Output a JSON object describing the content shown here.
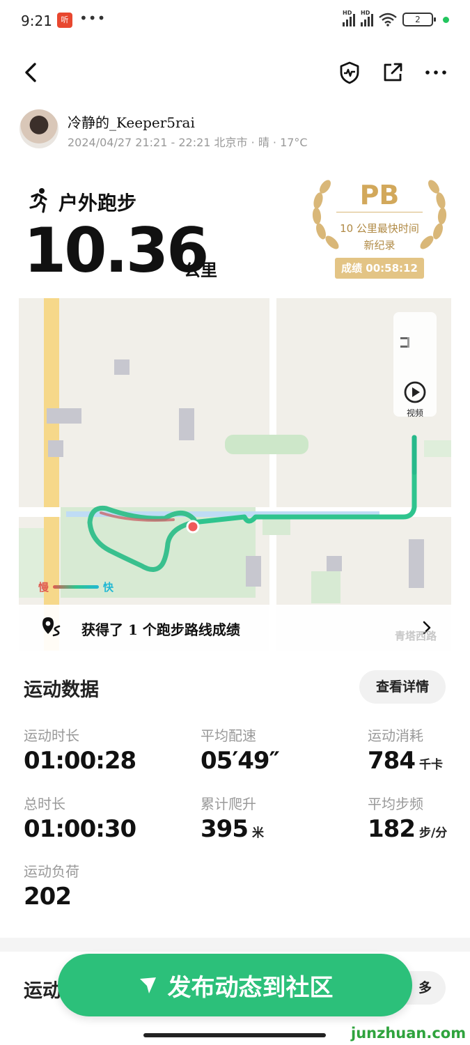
{
  "status_bar": {
    "time": "9:21",
    "app_badge": "听",
    "dots": "•••",
    "signal1_label": "HD",
    "signal2_label": "HD",
    "battery": "2"
  },
  "user": {
    "name": "冷静的_Keeper5rai",
    "meta": "2024/04/27 21:21 - 22:21 北京市 · 晴 · 17°C"
  },
  "activity": {
    "type": "户外跑步",
    "distance": "10.36",
    "distance_unit": "公里"
  },
  "pb_badge": {
    "title": "PB",
    "line1": "10 公里最快时间",
    "line2": "新纪录",
    "score": "成绩 00:58:12"
  },
  "map": {
    "video_label": "视频",
    "legend_slow": "慢",
    "legend_fast": "快",
    "route_banner": "获得了 1 个跑步路线成绩",
    "street_name": "青塔西路"
  },
  "stats_section": {
    "title": "运动数据",
    "detail_button": "查看详情",
    "items": [
      {
        "label": "运动时长",
        "value": "01:00:28",
        "unit": ""
      },
      {
        "label": "平均配速",
        "value": "05′49″",
        "unit": ""
      },
      {
        "label": "运动消耗",
        "value": "784",
        "unit": "千卡"
      },
      {
        "label": "总时长",
        "value": "01:00:30",
        "unit": ""
      },
      {
        "label": "累计爬升",
        "value": "395",
        "unit": "米"
      },
      {
        "label": "平均步频",
        "value": "182",
        "unit": "步/分"
      },
      {
        "label": "运动负荷",
        "value": "202",
        "unit": ""
      }
    ]
  },
  "lower_section": {
    "title_partial": "运动",
    "more_partial": "多"
  },
  "publish_button": "发布动态到社区",
  "watermark": "junzhuan.com",
  "colors": {
    "accent_green": "#2cc07a",
    "pb_gold": "#d2a85b",
    "route_green": "#2fc48e"
  }
}
